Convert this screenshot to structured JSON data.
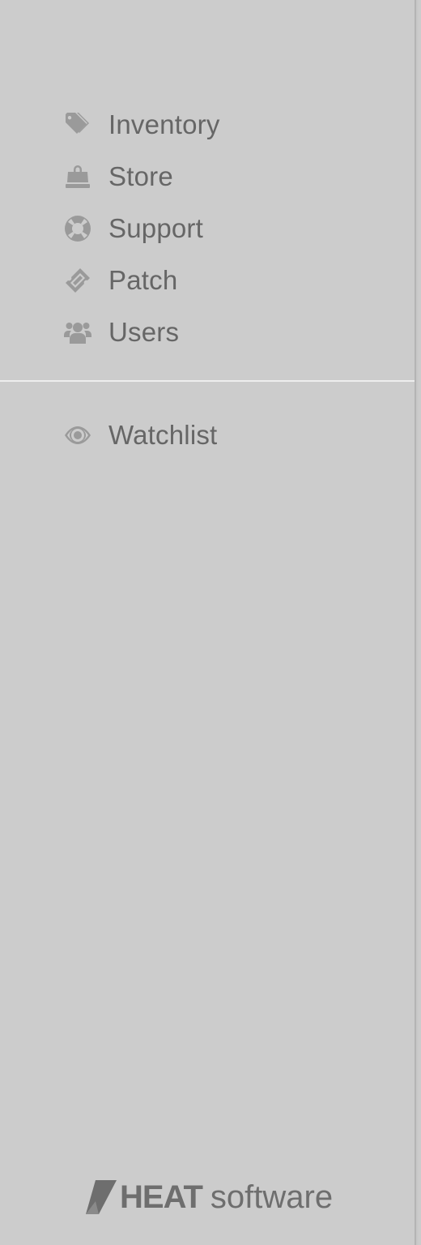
{
  "sidebar": {
    "items": [
      {
        "label": "Inventory",
        "icon": "tags-icon"
      },
      {
        "label": "Store",
        "icon": "shopping-bag-icon"
      },
      {
        "label": "Support",
        "icon": "life-ring-icon"
      },
      {
        "label": "Patch",
        "icon": "ticket-icon"
      },
      {
        "label": "Users",
        "icon": "users-icon"
      }
    ],
    "secondary_items": [
      {
        "label": "Watchlist",
        "icon": "eye-icon"
      }
    ]
  },
  "logo": {
    "brand": "HEAT",
    "suffix": "software"
  },
  "colors": {
    "background": "#cccccc",
    "text": "#666666",
    "icon": "#9a9a9a",
    "divider": "#eeeeee"
  }
}
